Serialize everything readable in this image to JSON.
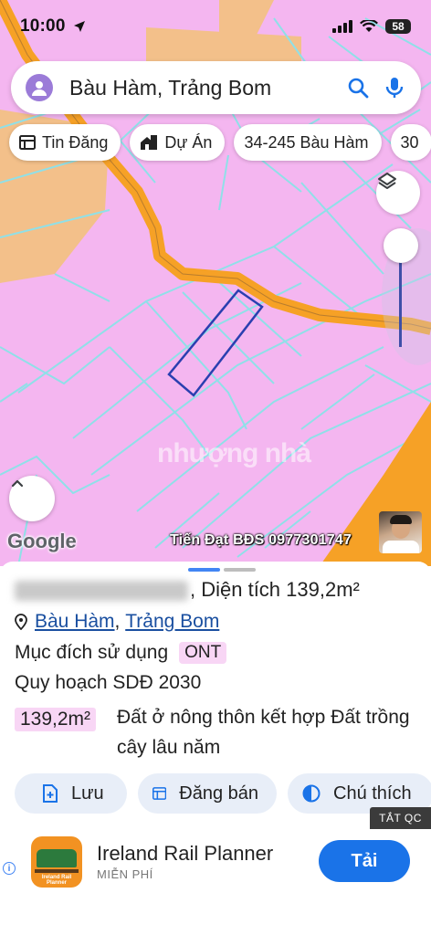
{
  "status_bar": {
    "time": "10:00",
    "battery": "58"
  },
  "search": {
    "query": "Bàu Hàm, Trảng Bom"
  },
  "chips": [
    {
      "label": "Tin Đăng",
      "icon": "listing-icon"
    },
    {
      "label": "Dự Án",
      "icon": "project-icon"
    },
    {
      "label": "34-245 Bàu Hàm",
      "icon": ""
    },
    {
      "label": "30",
      "icon": ""
    }
  ],
  "map": {
    "attribution": "Google",
    "watermark": "Tiến Đạt BĐS 0977301747",
    "center_watermark": "nhượng nhà",
    "colors": {
      "residential": "#f4b6f0",
      "road": "#f6a126",
      "cropland": "#f3c08a",
      "parcel_line": "#8fe0e8",
      "selected_parcel": "#2a3fb0"
    }
  },
  "parcel": {
    "title_suffix": ", Diện tích 139,2m²",
    "address_commune": "Bàu Hàm",
    "address_district": "Trảng Bom",
    "purpose_label": "Mục đích sử dụng",
    "purpose_code": "ONT",
    "plan_label": "Quy hoạch SDĐ 2030",
    "area_value": "139,2m²",
    "land_use": "Đất ở nông thôn kết hợp Đất trồng cây lâu năm"
  },
  "actions": {
    "save": "Lưu",
    "post": "Đăng bán",
    "legend": "Chú thích"
  },
  "ad": {
    "close_label": "TẮT QC",
    "app_name": "Ireland Rail Planner",
    "price": "MIỄN PHÍ",
    "cta": "Tải",
    "icon_text": "Ireland Rail Planner"
  }
}
